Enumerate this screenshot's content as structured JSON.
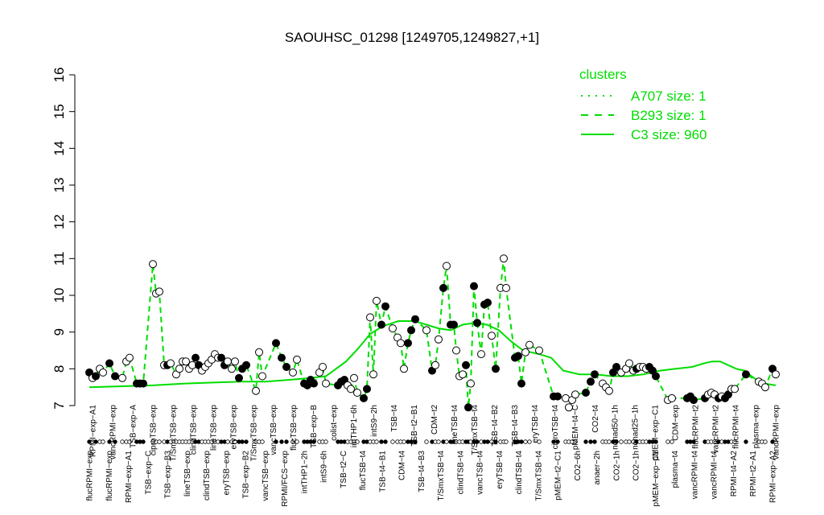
{
  "chart_data": {
    "type": "line",
    "title": "SAOUHSC_01298 [1249705,1249827,+1]",
    "xlabel": "",
    "ylabel": "",
    "ylim": [
      7,
      16
    ],
    "yticks": [
      7,
      8,
      9,
      10,
      11,
      12,
      13,
      14,
      15,
      16
    ],
    "legend": {
      "title": "clusters",
      "placement": "top-right",
      "entries": [
        {
          "label": "A707 size: 1",
          "style": "dotted"
        },
        {
          "label": "B293 size: 1",
          "style": "dashed"
        },
        {
          "label": "C3 size: 960",
          "style": "solid"
        }
      ]
    },
    "series_color": "#00dd00",
    "top_labels": [
      "RPMI−exp−A1",
      "vancRPMI−exp",
      "TSB−exp−A",
      "ciproTSB−exp",
      "T/SmxTSB−exp",
      "clindTSB−exp",
      "lineTSB−exp",
      "eryTSB−exp",
      "T/SmxTSB−exp",
      "vancTSB−exp",
      "flucTSB−exp",
      "TSB−exp−B",
      "colist−exp",
      "intTHP1−6h",
      "intS9−2h",
      "TSB−t4",
      "TSB−t2−B1",
      "CDM−t2",
      "lineTSB−t4",
      "T/SmxTSB−t4",
      "TSB−t4−B2",
      "TSB−t4−B3",
      "eryTSB−t4",
      "ciproTSB−t4",
      "pMEM−t4−C",
      "CO2−t4",
      "nonad50−1h",
      "nonad25−1h",
      "pMEM−exp−C1",
      "CDM−exp",
      "flucRPMI−t2",
      "vancRPMI−t2",
      "flucRPMI−t4",
      "plasma−exp",
      "vancRPMI−exp"
    ],
    "bottom_labels": [
      "flucRPMI−exp",
      "flucRPMI−exp",
      "RPMI−exp−A1",
      "TSB−exp−C",
      "TSB−exp−B3",
      "lineTSB−exp",
      "clindTSB−exp",
      "eryTSB−exp",
      "TSB−exp−B2",
      "vancTSB−exp",
      "RPMI/FCS−exp",
      "intTHP1−2h",
      "intS9−6h",
      "TSB−t2−C",
      "flucTSB−t4",
      "TSB−t4−B1",
      "CDM−t4",
      "TSB−t4−B3",
      "T/SmxTSB−t4",
      "clindTSB−t4",
      "vancTSB−t4",
      "eryTSB−t4",
      "clindTSB−t4",
      "T/SmxTSB−t4",
      "pMEM−t2−C1",
      "CO2−6h",
      "anaer−2h",
      "CO2−1h",
      "CO2−1h",
      "pMEM−exp−C1",
      "plasma−t4",
      "vancRPMI−t4",
      "vancRPMI−t4",
      "RPMI−t4−A2",
      "RPMI−t2−A1",
      "RPMI−exp−A2"
    ],
    "points": [
      {
        "x": 111,
        "y": 7.9,
        "filled": true
      },
      {
        "x": 115,
        "y": 7.75,
        "filled": false
      },
      {
        "x": 119,
        "y": 7.8,
        "filled": true
      },
      {
        "x": 124,
        "y": 8.0,
        "filled": false
      },
      {
        "x": 128,
        "y": 7.9,
        "filled": false
      },
      {
        "x": 136,
        "y": 8.15,
        "filled": true
      },
      {
        "x": 143,
        "y": 7.8,
        "filled": true
      },
      {
        "x": 152,
        "y": 7.75,
        "filled": false
      },
      {
        "x": 157,
        "y": 8.2,
        "filled": false
      },
      {
        "x": 161,
        "y": 8.3,
        "filled": false
      },
      {
        "x": 170,
        "y": 7.6,
        "filled": true
      },
      {
        "x": 174,
        "y": 7.6,
        "filled": true
      },
      {
        "x": 178,
        "y": 7.6,
        "filled": true
      },
      {
        "x": 190,
        "y": 10.85,
        "filled": false
      },
      {
        "x": 194,
        "y": 10.05,
        "filled": false
      },
      {
        "x": 198,
        "y": 10.1,
        "filled": false
      },
      {
        "x": 204,
        "y": 8.1,
        "filled": false
      },
      {
        "x": 208,
        "y": 8.1,
        "filled": true
      },
      {
        "x": 212,
        "y": 8.15,
        "filled": false
      },
      {
        "x": 219,
        "y": 7.85,
        "filled": false
      },
      {
        "x": 223,
        "y": 8.0,
        "filled": false
      },
      {
        "x": 227,
        "y": 8.2,
        "filled": false
      },
      {
        "x": 231,
        "y": 8.2,
        "filled": false
      },
      {
        "x": 235,
        "y": 8.0,
        "filled": false
      },
      {
        "x": 239,
        "y": 8.1,
        "filled": false
      },
      {
        "x": 243,
        "y": 8.3,
        "filled": true
      },
      {
        "x": 247,
        "y": 8.1,
        "filled": true
      },
      {
        "x": 251,
        "y": 7.95,
        "filled": false
      },
      {
        "x": 255,
        "y": 8.05,
        "filled": false
      },
      {
        "x": 259,
        "y": 8.15,
        "filled": false
      },
      {
        "x": 263,
        "y": 8.25,
        "filled": false
      },
      {
        "x": 267,
        "y": 8.4,
        "filled": false
      },
      {
        "x": 271,
        "y": 8.3,
        "filled": false
      },
      {
        "x": 275,
        "y": 8.3,
        "filled": true
      },
      {
        "x": 279,
        "y": 8.1,
        "filled": true
      },
      {
        "x": 283,
        "y": 8.2,
        "filled": false
      },
      {
        "x": 288,
        "y": 8.0,
        "filled": false
      },
      {
        "x": 292,
        "y": 8.2,
        "filled": false
      },
      {
        "x": 297,
        "y": 7.75,
        "filled": true
      },
      {
        "x": 301,
        "y": 8.0,
        "filled": true
      },
      {
        "x": 306,
        "y": 8.1,
        "filled": true
      },
      {
        "x": 318,
        "y": 7.4,
        "filled": false
      },
      {
        "x": 322,
        "y": 8.45,
        "filled": false
      },
      {
        "x": 326,
        "y": 7.8,
        "filled": false
      },
      {
        "x": 343,
        "y": 8.7,
        "filled": true
      },
      {
        "x": 350,
        "y": 8.3,
        "filled": true
      },
      {
        "x": 356,
        "y": 8.05,
        "filled": true
      },
      {
        "x": 364,
        "y": 7.9,
        "filled": false
      },
      {
        "x": 369,
        "y": 8.25,
        "filled": false
      },
      {
        "x": 378,
        "y": 7.6,
        "filled": true
      },
      {
        "x": 382,
        "y": 7.55,
        "filled": true
      },
      {
        "x": 386,
        "y": 7.7,
        "filled": true
      },
      {
        "x": 390,
        "y": 7.6,
        "filled": true
      },
      {
        "x": 397,
        "y": 7.9,
        "filled": false
      },
      {
        "x": 401,
        "y": 8.05,
        "filled": false
      },
      {
        "x": 405,
        "y": 7.6,
        "filled": false
      },
      {
        "x": 420,
        "y": 7.55,
        "filled": true
      },
      {
        "x": 424,
        "y": 7.65,
        "filled": true
      },
      {
        "x": 428,
        "y": 7.7,
        "filled": true
      },
      {
        "x": 432,
        "y": 7.55,
        "filled": false
      },
      {
        "x": 436,
        "y": 7.45,
        "filled": false
      },
      {
        "x": 440,
        "y": 7.75,
        "filled": false
      },
      {
        "x": 444,
        "y": 7.35,
        "filled": false
      },
      {
        "x": 452,
        "y": 7.2,
        "filled": true
      },
      {
        "x": 456,
        "y": 7.45,
        "filled": true
      },
      {
        "x": 460,
        "y": 9.4,
        "filled": false
      },
      {
        "x": 464,
        "y": 7.85,
        "filled": false
      },
      {
        "x": 468,
        "y": 9.85,
        "filled": false
      },
      {
        "x": 474,
        "y": 9.2,
        "filled": true
      },
      {
        "x": 479,
        "y": 9.7,
        "filled": true
      },
      {
        "x": 488,
        "y": 9.1,
        "filled": false
      },
      {
        "x": 494,
        "y": 8.85,
        "filled": false
      },
      {
        "x": 498,
        "y": 8.7,
        "filled": false
      },
      {
        "x": 502,
        "y": 8.0,
        "filled": false
      },
      {
        "x": 507,
        "y": 8.7,
        "filled": true
      },
      {
        "x": 511,
        "y": 9.05,
        "filled": true
      },
      {
        "x": 516,
        "y": 9.35,
        "filled": true
      },
      {
        "x": 530,
        "y": 9.05,
        "filled": false
      },
      {
        "x": 537,
        "y": 7.95,
        "filled": true
      },
      {
        "x": 541,
        "y": 8.1,
        "filled": false
      },
      {
        "x": 545,
        "y": 8.8,
        "filled": false
      },
      {
        "x": 551,
        "y": 10.2,
        "filled": true
      },
      {
        "x": 555,
        "y": 10.8,
        "filled": false
      },
      {
        "x": 560,
        "y": 9.2,
        "filled": true
      },
      {
        "x": 564,
        "y": 9.2,
        "filled": true
      },
      {
        "x": 567,
        "y": 8.5,
        "filled": false
      },
      {
        "x": 571,
        "y": 7.8,
        "filled": false
      },
      {
        "x": 575,
        "y": 7.85,
        "filled": false
      },
      {
        "x": 579,
        "y": 8.1,
        "filled": true
      },
      {
        "x": 582,
        "y": 6.95,
        "filled": true
      },
      {
        "x": 585,
        "y": 7.6,
        "filled": false
      },
      {
        "x": 589,
        "y": 10.25,
        "filled": true
      },
      {
        "x": 593,
        "y": 9.25,
        "filled": true
      },
      {
        "x": 598,
        "y": 8.4,
        "filled": false
      },
      {
        "x": 602,
        "y": 9.75,
        "filled": true
      },
      {
        "x": 606,
        "y": 9.8,
        "filled": true
      },
      {
        "x": 611,
        "y": 8.9,
        "filled": false
      },
      {
        "x": 616,
        "y": 8.0,
        "filled": true
      },
      {
        "x": 622,
        "y": 10.2,
        "filled": false
      },
      {
        "x": 626,
        "y": 11.0,
        "filled": false
      },
      {
        "x": 629,
        "y": 10.2,
        "filled": false
      },
      {
        "x": 640,
        "y": 8.3,
        "filled": true
      },
      {
        "x": 644,
        "y": 8.35,
        "filled": true
      },
      {
        "x": 648,
        "y": 7.6,
        "filled": true
      },
      {
        "x": 653,
        "y": 8.45,
        "filled": false
      },
      {
        "x": 658,
        "y": 8.65,
        "filled": false
      },
      {
        "x": 670,
        "y": 8.5,
        "filled": false
      },
      {
        "x": 688,
        "y": 7.25,
        "filled": true
      },
      {
        "x": 693,
        "y": 7.25,
        "filled": true
      },
      {
        "x": 703,
        "y": 7.2,
        "filled": false
      },
      {
        "x": 707,
        "y": 6.95,
        "filled": false
      },
      {
        "x": 711,
        "y": 7.15,
        "filled": false
      },
      {
        "x": 715,
        "y": 7.3,
        "filled": false
      },
      {
        "x": 728,
        "y": 7.35,
        "filled": true
      },
      {
        "x": 734,
        "y": 7.65,
        "filled": true
      },
      {
        "x": 739,
        "y": 7.85,
        "filled": true
      },
      {
        "x": 749,
        "y": 7.6,
        "filled": false
      },
      {
        "x": 753,
        "y": 7.5,
        "filled": false
      },
      {
        "x": 757,
        "y": 7.4,
        "filled": false
      },
      {
        "x": 762,
        "y": 7.9,
        "filled": true
      },
      {
        "x": 766,
        "y": 8.05,
        "filled": true
      },
      {
        "x": 772,
        "y": 7.9,
        "filled": false
      },
      {
        "x": 778,
        "y": 8.0,
        "filled": false
      },
      {
        "x": 782,
        "y": 8.15,
        "filled": false
      },
      {
        "x": 787,
        "y": 7.95,
        "filled": false
      },
      {
        "x": 791,
        "y": 8.0,
        "filled": true
      },
      {
        "x": 795,
        "y": 8.05,
        "filled": false
      },
      {
        "x": 799,
        "y": 8.05,
        "filled": false
      },
      {
        "x": 803,
        "y": 8.0,
        "filled": false
      },
      {
        "x": 807,
        "y": 8.05,
        "filled": true
      },
      {
        "x": 811,
        "y": 7.95,
        "filled": true
      },
      {
        "x": 815,
        "y": 7.8,
        "filled": true
      },
      {
        "x": 830,
        "y": 7.15,
        "filled": false
      },
      {
        "x": 835,
        "y": 7.2,
        "filled": false
      },
      {
        "x": 854,
        "y": 7.2,
        "filled": true
      },
      {
        "x": 858,
        "y": 7.25,
        "filled": true
      },
      {
        "x": 862,
        "y": 7.15,
        "filled": true
      },
      {
        "x": 876,
        "y": 7.2,
        "filled": true
      },
      {
        "x": 880,
        "y": 7.3,
        "filled": false
      },
      {
        "x": 884,
        "y": 7.35,
        "filled": false
      },
      {
        "x": 888,
        "y": 7.3,
        "filled": false
      },
      {
        "x": 893,
        "y": 7.2,
        "filled": true
      },
      {
        "x": 897,
        "y": 7.25,
        "filled": false
      },
      {
        "x": 901,
        "y": 7.2,
        "filled": true
      },
      {
        "x": 905,
        "y": 7.3,
        "filled": true
      },
      {
        "x": 909,
        "y": 7.45,
        "filled": false
      },
      {
        "x": 913,
        "y": 7.45,
        "filled": false
      },
      {
        "x": 927,
        "y": 7.85,
        "filled": true
      },
      {
        "x": 943,
        "y": 7.65,
        "filled": false
      },
      {
        "x": 947,
        "y": 7.6,
        "filled": false
      },
      {
        "x": 951,
        "y": 7.5,
        "filled": false
      },
      {
        "x": 960,
        "y": 8.0,
        "filled": true
      },
      {
        "x": 964,
        "y": 7.85,
        "filled": false
      }
    ],
    "cluster_line": [
      [
        111,
        7.5
      ],
      [
        190,
        7.55
      ],
      [
        230,
        7.6
      ],
      [
        300,
        7.65
      ],
      [
        330,
        7.65
      ],
      [
        360,
        7.7
      ],
      [
        385,
        7.75
      ],
      [
        405,
        7.8
      ],
      [
        430,
        8.2
      ],
      [
        445,
        8.55
      ],
      [
        460,
        8.95
      ],
      [
        475,
        9.15
      ],
      [
        495,
        9.3
      ],
      [
        515,
        9.3
      ],
      [
        530,
        9.2
      ],
      [
        545,
        9.1
      ],
      [
        560,
        9.05
      ],
      [
        575,
        9.2
      ],
      [
        590,
        9.25
      ],
      [
        605,
        9.2
      ],
      [
        620,
        9.05
      ],
      [
        635,
        8.75
      ],
      [
        650,
        8.5
      ],
      [
        670,
        8.4
      ],
      [
        685,
        8.3
      ],
      [
        700,
        7.95
      ],
      [
        720,
        7.85
      ],
      [
        740,
        7.85
      ],
      [
        760,
        7.8
      ],
      [
        780,
        7.8
      ],
      [
        800,
        7.85
      ],
      [
        820,
        7.95
      ],
      [
        840,
        8.0
      ],
      [
        860,
        8.05
      ],
      [
        875,
        8.15
      ],
      [
        885,
        8.2
      ],
      [
        895,
        8.2
      ],
      [
        905,
        8.1
      ],
      [
        915,
        8.0
      ],
      [
        925,
        7.95
      ],
      [
        940,
        7.7
      ],
      [
        950,
        7.6
      ],
      [
        964,
        7.55
      ]
    ]
  }
}
